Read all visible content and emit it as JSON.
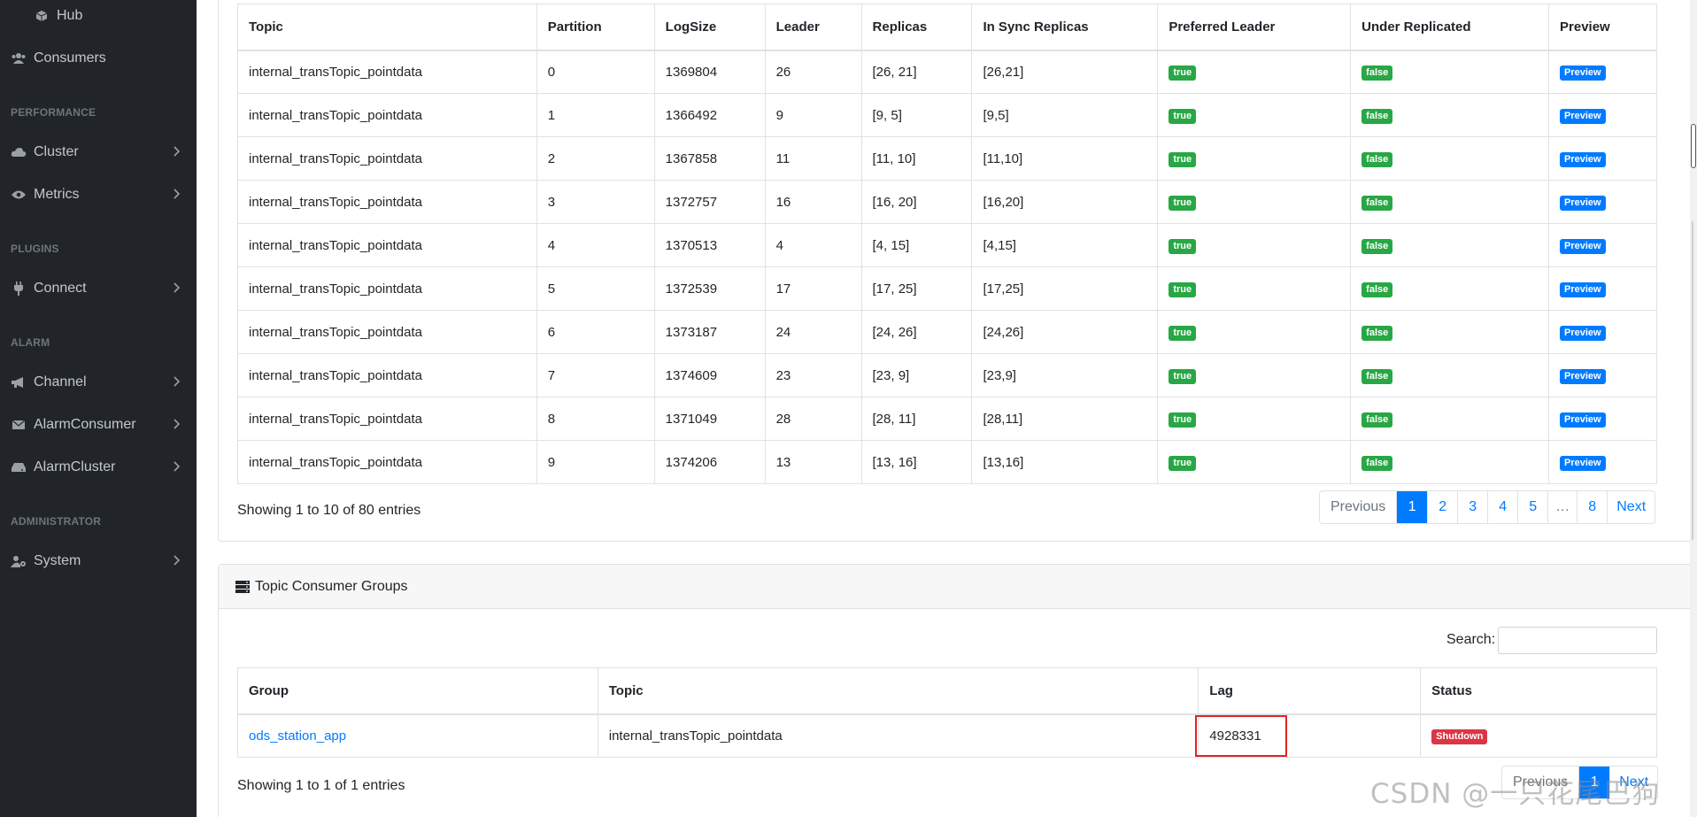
{
  "sidebar": {
    "hub_label": "Hub",
    "consumers_label": "Consumers",
    "performance_heading": "PERFORMANCE",
    "cluster_label": "Cluster",
    "metrics_label": "Metrics",
    "plugins_heading": "PLUGINS",
    "connect_label": "Connect",
    "alarm_heading": "ALARM",
    "channel_label": "Channel",
    "alarm_consumer_label": "AlarmConsumer",
    "alarm_cluster_label": "AlarmCluster",
    "administrator_heading": "ADMINISTRATOR",
    "system_label": "System"
  },
  "partitions": {
    "headers": [
      "Topic",
      "Partition",
      "LogSize",
      "Leader",
      "Replicas",
      "In Sync Replicas",
      "Preferred Leader",
      "Under Replicated",
      "Preview"
    ],
    "rows": [
      [
        "internal_transTopic_pointdata",
        "0",
        "1369804",
        "26",
        "[26, 21]",
        "[26,21]",
        "true",
        "false",
        "Preview"
      ],
      [
        "internal_transTopic_pointdata",
        "1",
        "1366492",
        "9",
        "[9, 5]",
        "[9,5]",
        "true",
        "false",
        "Preview"
      ],
      [
        "internal_transTopic_pointdata",
        "2",
        "1367858",
        "11",
        "[11, 10]",
        "[11,10]",
        "true",
        "false",
        "Preview"
      ],
      [
        "internal_transTopic_pointdata",
        "3",
        "1372757",
        "16",
        "[16, 20]",
        "[16,20]",
        "true",
        "false",
        "Preview"
      ],
      [
        "internal_transTopic_pointdata",
        "4",
        "1370513",
        "4",
        "[4, 15]",
        "[4,15]",
        "true",
        "false",
        "Preview"
      ],
      [
        "internal_transTopic_pointdata",
        "5",
        "1372539",
        "17",
        "[17, 25]",
        "[17,25]",
        "true",
        "false",
        "Preview"
      ],
      [
        "internal_transTopic_pointdata",
        "6",
        "1373187",
        "24",
        "[24, 26]",
        "[24,26]",
        "true",
        "false",
        "Preview"
      ],
      [
        "internal_transTopic_pointdata",
        "7",
        "1374609",
        "23",
        "[23, 9]",
        "[23,9]",
        "true",
        "false",
        "Preview"
      ],
      [
        "internal_transTopic_pointdata",
        "8",
        "1371049",
        "28",
        "[28, 11]",
        "[28,11]",
        "true",
        "false",
        "Preview"
      ],
      [
        "internal_transTopic_pointdata",
        "9",
        "1374206",
        "13",
        "[13, 16]",
        "[13,16]",
        "true",
        "false",
        "Preview"
      ]
    ],
    "info": "Showing 1 to 10 of 80 entries",
    "pager": {
      "previous": "Previous",
      "pages": [
        "1",
        "2",
        "3",
        "4",
        "5",
        "…",
        "8"
      ],
      "next": "Next",
      "active": "1"
    }
  },
  "consumer_groups": {
    "title": "Topic Consumer Groups",
    "search_label": "Search:",
    "search_value": "",
    "headers": [
      "Group",
      "Topic",
      "Lag",
      "Status"
    ],
    "rows": [
      {
        "group": "ods_station_app",
        "topic": "internal_transTopic_pointdata",
        "lag": "4928331",
        "status": "Shutdown"
      }
    ],
    "info": "Showing 1 to 1 of 1 entries",
    "pager": {
      "previous": "Previous",
      "page": "1",
      "next": "Next"
    }
  },
  "watermark": "CSDN @一只花尾巴狗",
  "colors": {
    "sidebar_bg": "#212529",
    "primary": "#007bff",
    "success": "#28a745",
    "danger": "#dc3545",
    "highlight_box": "#e02424"
  }
}
